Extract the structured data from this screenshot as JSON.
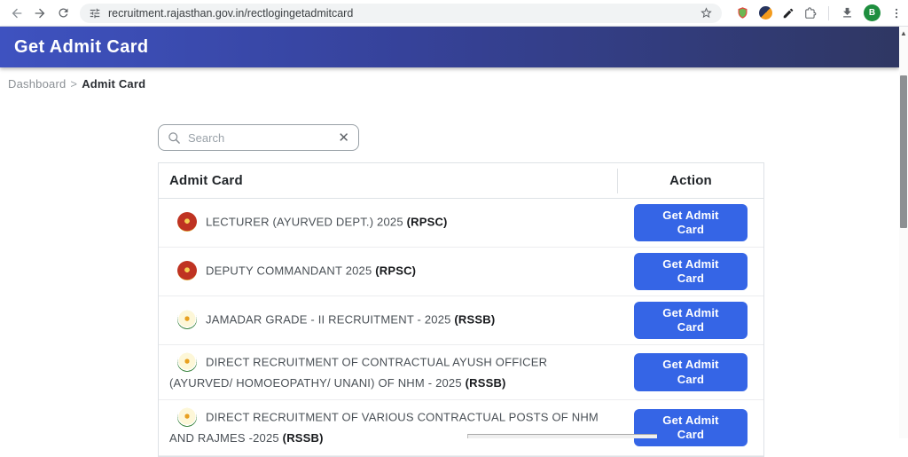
{
  "browser": {
    "url": "recruitment.rajasthan.gov.in/rectlogingetadmitcard",
    "profile_initial": "B"
  },
  "page": {
    "title": "Get Admit Card",
    "breadcrumb": {
      "parent": "Dashboard",
      "separator": ">",
      "current": "Admit Card"
    },
    "search_placeholder": "Search",
    "clear_icon": "✕",
    "table": {
      "header": {
        "admit_card": "Admit Card",
        "action": "Action"
      },
      "action_button_label": "Get Admit Card",
      "rows": [
        {
          "org": "rpsc",
          "title": "LECTURER (AYURVED DEPT.) 2025",
          "org_tag": "(RPSC)"
        },
        {
          "org": "rpsc",
          "title": "DEPUTY COMMANDANT 2025",
          "org_tag": "(RPSC)"
        },
        {
          "org": "rssb",
          "title": "JAMADAR GRADE - II RECRUITMENT - 2025",
          "org_tag": "(RSSB)"
        },
        {
          "org": "rssb",
          "title": "DIRECT RECRUITMENT OF CONTRACTUAL AYUSH OFFICER (AYURVED/ HOMOEOPATHY/ UNANI) OF NHM - 2025",
          "org_tag": "(RSSB)"
        },
        {
          "org": "rssb",
          "title": "DIRECT RECRUITMENT OF VARIOUS CONTRACTUAL POSTS OF NHM AND RAJMES -2025",
          "org_tag": "(RSSB)"
        }
      ]
    },
    "colors": {
      "banner_gradient_start": "#3e52c0",
      "banner_gradient_end": "#2f3763",
      "action_button_blue": "#3565e6",
      "rpsc_red": "#bf3322",
      "rpsc_gold": "#e0a93c",
      "rssb_green": "#2e7d32",
      "avatar_green": "#1e8e3e"
    }
  }
}
